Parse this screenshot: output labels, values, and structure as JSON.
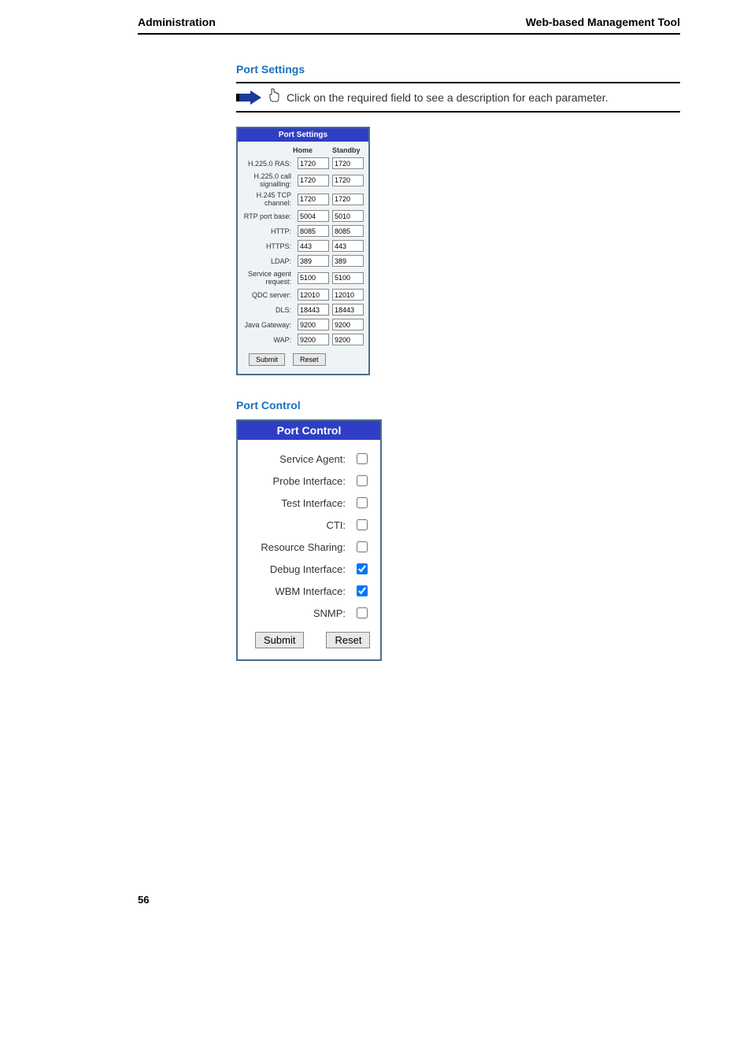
{
  "header": {
    "left": "Administration",
    "right": "Web-based Management Tool"
  },
  "note_text": "Click on the required field to see a description for each parameter.",
  "port_settings": {
    "heading": "Port Settings",
    "panel_title": "Port Settings",
    "col_home": "Home",
    "col_standby": "Standby",
    "rows": [
      {
        "label": "H.225.0 RAS:",
        "home": "1720",
        "standby": "1720"
      },
      {
        "label": "H.225.0 call signalling:",
        "home": "1720",
        "standby": "1720"
      },
      {
        "label": "H.245 TCP channel:",
        "home": "1720",
        "standby": "1720"
      },
      {
        "label": "RTP port base:",
        "home": "5004",
        "standby": "5010"
      },
      {
        "label": "HTTP:",
        "home": "8085",
        "standby": "8085"
      },
      {
        "label": "HTTPS:",
        "home": "443",
        "standby": "443"
      },
      {
        "label": "LDAP:",
        "home": "389",
        "standby": "389"
      },
      {
        "label": "Service agent request:",
        "home": "5100",
        "standby": "5100"
      },
      {
        "label": "QDC server:",
        "home": "12010",
        "standby": "12010"
      },
      {
        "label": "DLS:",
        "home": "18443",
        "standby": "18443"
      },
      {
        "label": "Java Gateway:",
        "home": "9200",
        "standby": "9200"
      },
      {
        "label": "WAP:",
        "home": "9200",
        "standby": "9200"
      }
    ],
    "submit": "Submit",
    "reset": "Reset"
  },
  "port_control": {
    "heading": "Port Control",
    "panel_title": "Port Control",
    "rows": [
      {
        "label": "Service Agent:",
        "checked": false
      },
      {
        "label": "Probe Interface:",
        "checked": false
      },
      {
        "label": "Test Interface:",
        "checked": false
      },
      {
        "label": "CTI:",
        "checked": false
      },
      {
        "label": "Resource Sharing:",
        "checked": false
      },
      {
        "label": "Debug Interface:",
        "checked": true
      },
      {
        "label": "WBM Interface:",
        "checked": true
      },
      {
        "label": "SNMP:",
        "checked": false
      }
    ],
    "submit": "Submit",
    "reset": "Reset"
  },
  "page_number": "56"
}
